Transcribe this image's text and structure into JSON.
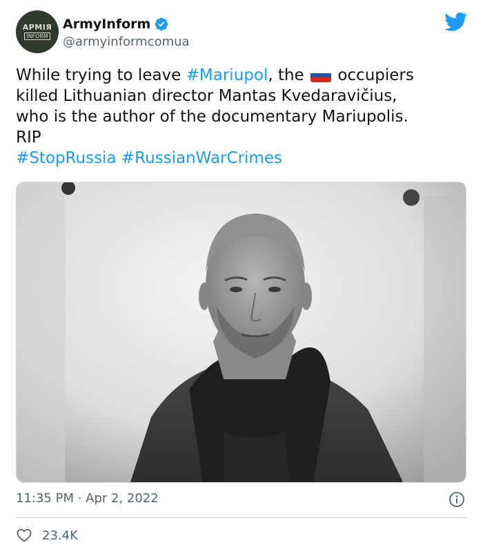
{
  "author": {
    "avatar_line1": "АРМІЯ",
    "avatar_line2": "INFORM",
    "display_name": "ArmyInform",
    "handle": "@armyinformcomua"
  },
  "tweet": {
    "lines": [
      {
        "a": "While trying to leave ",
        "tag": "#Mariupol",
        "b": ", the",
        "c": " occupiers"
      },
      {
        "text": "killed Lithuanian director Mantas Kvedaravičius,"
      },
      {
        "text": "who is the author of the documentary Mariupolis."
      },
      {
        "text": "RIP"
      }
    ],
    "hashtags": [
      "#StopRussia",
      "#RussianWarCrimes"
    ],
    "flag_colors": [
      "#ffffff",
      "#1c57a7",
      "#d52b1e"
    ]
  },
  "footer": {
    "timestamp": "11:35 PM · Apr 2, 2022",
    "likes": "23.4K"
  },
  "colors": {
    "accent": "#1d9bf0",
    "text": "#0f1419",
    "secondary": "#536471",
    "border": "#cfd9de"
  },
  "icons": {
    "brand": "twitter-bird-icon",
    "verified": "verified-badge-icon",
    "info": "info-icon",
    "like": "heart-icon"
  }
}
